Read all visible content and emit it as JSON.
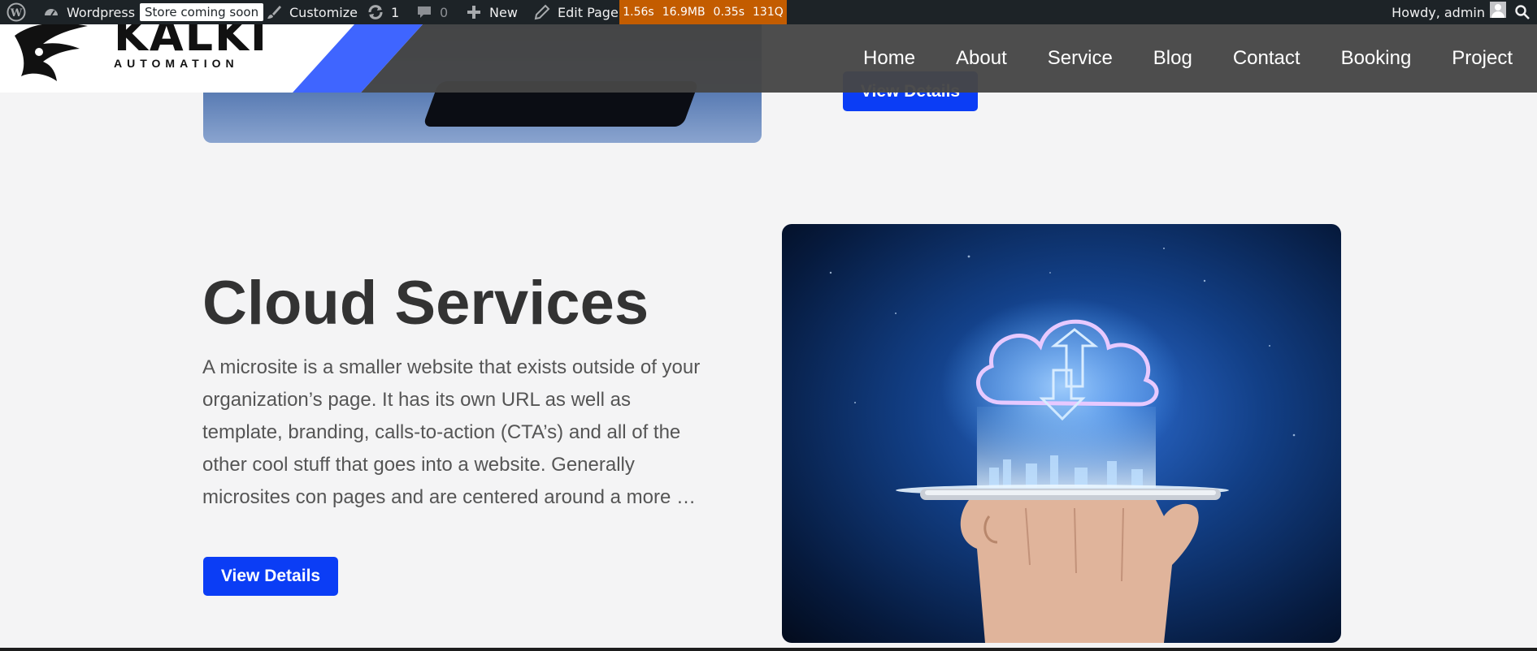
{
  "adminbar": {
    "site_name": "Wordpress",
    "store_badge": "Store coming soon",
    "customize": "Customize",
    "updates_count": "1",
    "comments_count": "0",
    "new_label": "New",
    "edit_page": "Edit Page",
    "query_monitor": [
      "1.56s",
      "16.9MB",
      "0.35s",
      "131Q"
    ],
    "howdy": "Howdy, admin",
    "accent_color": "#c35c00"
  },
  "header": {
    "logo_text": "KALKI",
    "logo_subtext": "AUTOMATION",
    "nav": [
      "Home",
      "About",
      "Service",
      "Blog",
      "Contact",
      "Booking",
      "Project"
    ]
  },
  "previous_section": {
    "button_label": "View Details"
  },
  "service": {
    "title": "Cloud Services",
    "description": "A microsite is a smaller website that exists outside of your organization’s page. It has its own URL as well as template, branding, calls-to-action (CTA’s) and all of the other cool stuff that goes into a website. Generally microsites con pages and are centered around a more …",
    "button_label": "View Details"
  },
  "colors": {
    "primary_button": "#0b3df5",
    "header_bg": "#464646",
    "logo_accent": "#3f65ff"
  }
}
